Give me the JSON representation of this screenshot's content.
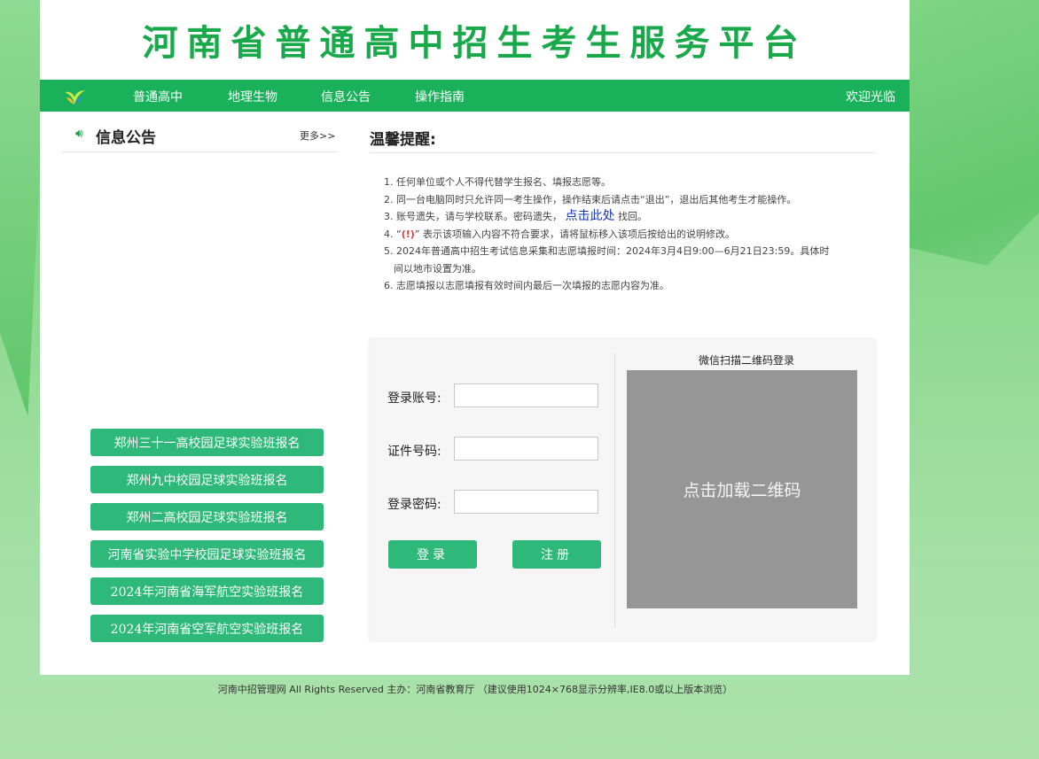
{
  "header": {
    "title": "河南省普通高中招生考生服务平台"
  },
  "nav": {
    "items": [
      "普通高中",
      "地理生物",
      "信息公告",
      "操作指南"
    ],
    "welcome": "欢迎光临"
  },
  "notice": {
    "icon": "speaker-icon",
    "title": "信息公告",
    "more": "更多>>"
  },
  "registrations": [
    "郑州三十一高校园足球实验班报名",
    "郑州九中校园足球实验班报名",
    "郑州二高校园足球实验班报名",
    "河南省实验中学校园足球实验班报名",
    "2024年河南省海军航空实验班报名",
    "2024年河南省空军航空实验班报名"
  ],
  "tips": {
    "title": "温馨提醒:",
    "item1": "1. 任何单位或个人不得代替学生报名、填报志愿等。",
    "item2": "2. 同一台电脑同时只允许同一考生操作，操作结束后请点击“退出”，退出后其他考生才能操作。",
    "item3_pre": "3. 账号遗失，请与学校联系。密码遗失，",
    "item3_link": "点击此处",
    "item3_post": "找回。",
    "item4_pre": "4. “",
    "item4_icon": "!",
    "item4_post": "” 表示该项输入内容不符合要求，请将鼠标移入该项后按给出的说明修改。",
    "item5_line1": "5. 2024年普通高中招生考试信息采集和志愿填报时间：2024年3月4日9:00—6月21日23:59。具体时",
    "item5_line2": "间以地市设置为准。",
    "item6": "6. 志愿填报以志愿填报有效时间内最后一次填报的志愿内容为准。"
  },
  "login": {
    "account_label": "登录账号:",
    "account_value": "",
    "id_label": "证件号码:",
    "id_value": "",
    "password_label": "登录密码:",
    "password_value": "",
    "login_button": "登录",
    "register_button": "注册",
    "qr_title": "微信扫描二维码登录",
    "qr_placeholder": "点击加载二维码"
  },
  "footer": {
    "text": "河南中招管理网 All Rights Reserved 主办：河南省教育厅 （建议使用1024×768显示分辨率,IE8.0或以上版本浏览）"
  },
  "colors": {
    "brand_green": "#19b15a",
    "button_green": "#2eb87a",
    "title_green": "#19a84a",
    "link_blue": "#1936b6"
  }
}
